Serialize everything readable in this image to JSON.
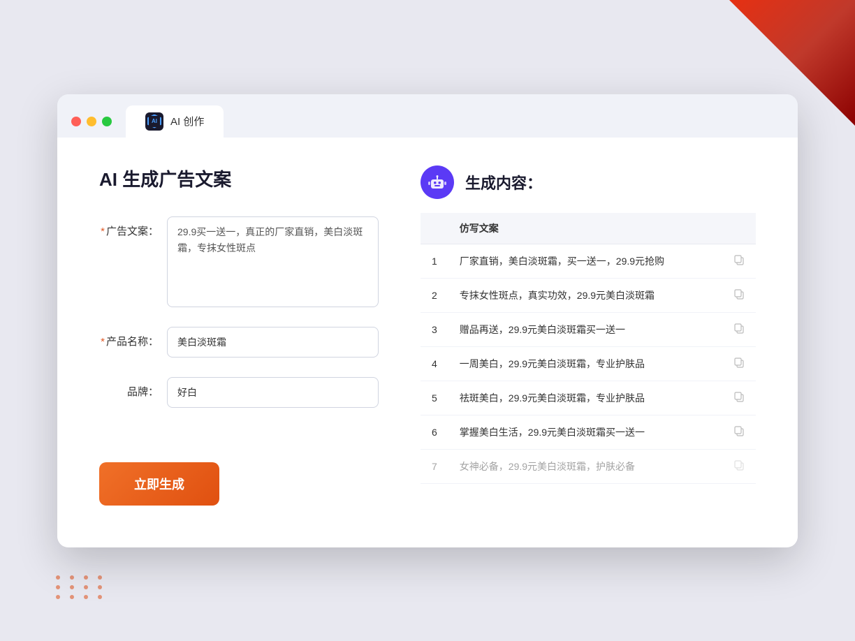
{
  "window": {
    "tab_label": "AI 创作",
    "controls": [
      "close",
      "minimize",
      "maximize"
    ]
  },
  "left_panel": {
    "title": "AI 生成广告文案",
    "form": {
      "ad_copy_label": "广告文案：",
      "ad_copy_required": "*",
      "ad_copy_value": "29.9买一送一，真正的厂家直销，美白淡斑霜，专抹女性斑点",
      "product_name_label": "产品名称：",
      "product_name_required": "*",
      "product_name_value": "美白淡斑霜",
      "brand_label": "品牌：",
      "brand_value": "好白"
    },
    "generate_button": "立即生成"
  },
  "right_panel": {
    "title": "生成内容：",
    "robot_icon": "🤖",
    "table": {
      "header": "仿写文案",
      "rows": [
        {
          "id": 1,
          "text": "厂家直销，美白淡斑霜，买一送一，29.9元抢购"
        },
        {
          "id": 2,
          "text": "专抹女性斑点，真实功效，29.9元美白淡斑霜"
        },
        {
          "id": 3,
          "text": "赠品再送，29.9元美白淡斑霜买一送一"
        },
        {
          "id": 4,
          "text": "一周美白，29.9元美白淡斑霜，专业护肤品"
        },
        {
          "id": 5,
          "text": "祛斑美白，29.9元美白淡斑霜，专业护肤品"
        },
        {
          "id": 6,
          "text": "掌握美白生活，29.9元美白淡斑霜买一送一"
        },
        {
          "id": 7,
          "text": "女神必备，29.9元美白淡斑霜，护肤必备"
        }
      ]
    }
  }
}
